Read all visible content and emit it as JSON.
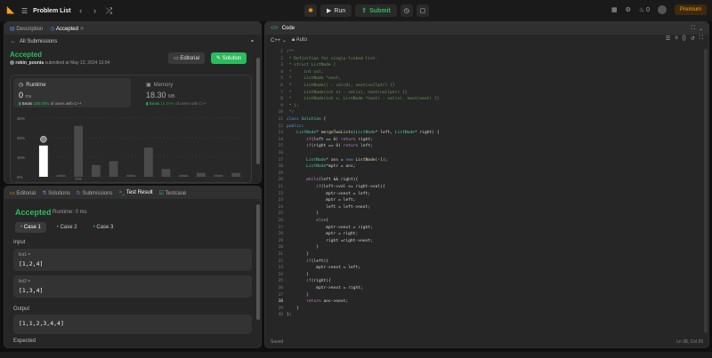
{
  "topbar": {
    "title": "Problem List",
    "run": "Run",
    "submit": "Submit",
    "premium": "Premium",
    "streak": "0"
  },
  "left_panel": {
    "tabs": [
      {
        "label": "Description"
      },
      {
        "label": "Accepted"
      }
    ],
    "back": "All Submissions",
    "status": "Accepted",
    "user": "robin_poonia",
    "submitted": "submitted at May 13, 2024 13:04",
    "editorial_btn": "Editorial",
    "solution_btn": "Solution",
    "runtime": {
      "label": "Runtime",
      "value": "0",
      "unit": "ms",
      "beats_prefix": "Beats",
      "beats_pct": "100.00%",
      "beats_suffix": "of users with C++"
    },
    "memory": {
      "label": "Memory",
      "value": "18.30",
      "unit": "MB",
      "beats_prefix": "Beats",
      "beats_pct": "16.09%",
      "beats_suffix": "of users with C++"
    }
  },
  "chart_data": {
    "type": "bar",
    "yticks": [
      "30%",
      "20%",
      "10%",
      "0%"
    ],
    "ylim": [
      0,
      30
    ],
    "values": [
      16,
      1,
      26,
      6,
      8,
      1,
      15,
      4,
      1,
      2,
      1,
      2
    ],
    "highlight_index": 0,
    "xlabels": [
      "",
      "",
      "5ms",
      "",
      "",
      "",
      "",
      "",
      "",
      "",
      "",
      ""
    ]
  },
  "bottom_panel": {
    "tabs": [
      {
        "label": "Editorial"
      },
      {
        "label": "Solutions"
      },
      {
        "label": "Submissions"
      },
      {
        "label": "Test Result"
      },
      {
        "label": "Testcase"
      }
    ],
    "result": "Accepted",
    "runtime": "Runtime: 0 ms",
    "cases": [
      "Case 1",
      "Case 2",
      "Case 3"
    ],
    "input_label": "Input",
    "fields": [
      {
        "key": "list1 =",
        "value": "[1,2,4]"
      },
      {
        "key": "list2 =",
        "value": "[1,3,4]"
      }
    ],
    "output_label": "Output",
    "output": "[1,1,2,3,4,4]",
    "expected_label": "Expected"
  },
  "code_panel": {
    "title": "Code",
    "lang": "C++",
    "mode": "Auto",
    "status_left": "Saved",
    "status_right": "Ln 38, Col 26"
  }
}
